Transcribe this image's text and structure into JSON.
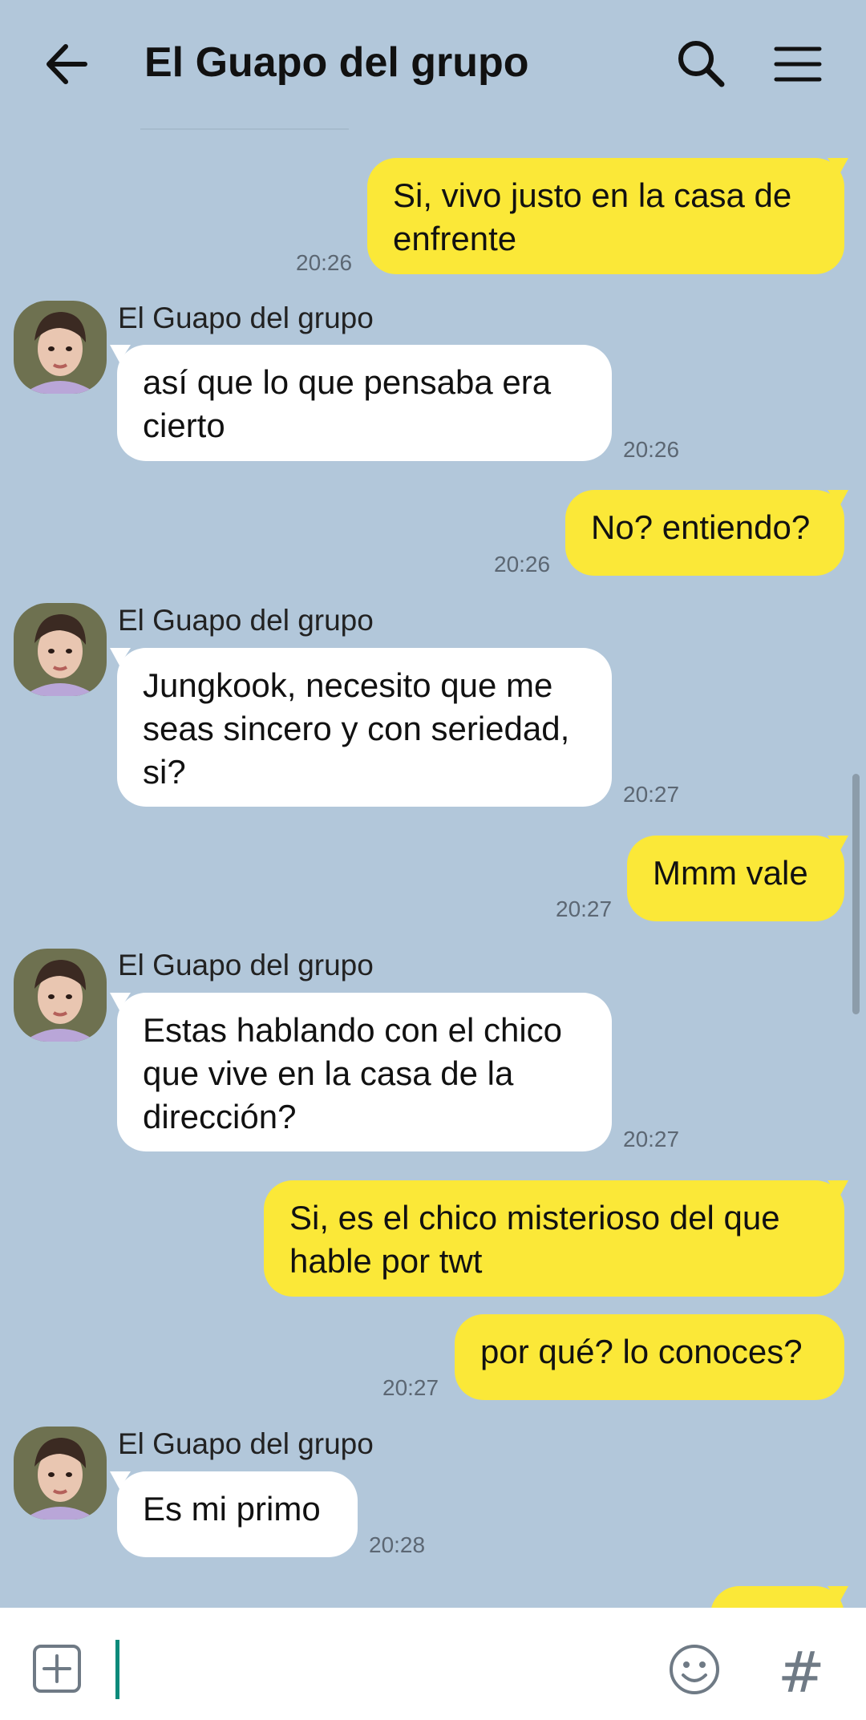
{
  "header": {
    "title": "El Guapo del grupo",
    "back_icon": "arrow-left-icon",
    "search_icon": "search-icon",
    "menu_icon": "hamburger-menu-icon"
  },
  "messages": [
    {
      "sender": "me",
      "text": "Si, vivo justo en la casa de enfrente",
      "time": "20:26"
    },
    {
      "sender": "them",
      "name": "El Guapo del grupo",
      "text": "así que lo que pensaba era cierto",
      "time": "20:26"
    },
    {
      "sender": "me",
      "text": "No? entiendo?",
      "time": "20:26"
    },
    {
      "sender": "them",
      "name": "El Guapo del grupo",
      "text": "Jungkook, necesito que me seas sincero y con seriedad, si?",
      "time": "20:27"
    },
    {
      "sender": "me",
      "text": "Mmm vale",
      "time": "20:27"
    },
    {
      "sender": "them",
      "name": "El Guapo del grupo",
      "text": "Estas hablando con el chico que vive en la casa de la dirección?",
      "time": "20:27"
    },
    {
      "sender": "me",
      "text": "Si, es el chico misterioso del que hable por twt",
      "time": ""
    },
    {
      "sender": "me",
      "text": "por qué? lo conoces?",
      "time": "20:27"
    },
    {
      "sender": "them",
      "name": "El Guapo del grupo",
      "text": "Es mi primo",
      "time": "20:28"
    }
  ],
  "composer": {
    "add_icon": "plus-square-icon",
    "emoji_icon": "smiley-icon",
    "hash_label": "#",
    "placeholder": ""
  },
  "colors": {
    "background": "#b2c7da",
    "my_bubble": "#fbe838",
    "their_bubble": "#ffffff"
  }
}
